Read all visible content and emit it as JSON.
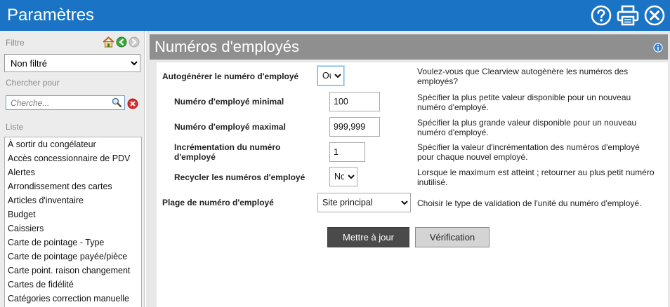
{
  "window": {
    "title": "Paramètres",
    "icons": [
      "help-icon",
      "print-icon",
      "close-icon"
    ]
  },
  "sidebar": {
    "filter_label": "Filtre",
    "filter_value": "Non filtré",
    "search_label": "Chercher pour",
    "search_placeholder": "Cherche...",
    "list_label": "Liste",
    "items": [
      "À sortir du congélateur",
      "Accès concessionnaire de PDV",
      "Alertes",
      "Arrondissement des cartes",
      "Articles d'inventaire",
      "Budget",
      "Caissiers",
      "Carte de pointage - Type",
      "Carte de pointage payée/pièce",
      "Carte point. raison changement",
      "Cartes de fidélité",
      "Catégories correction manuelle"
    ]
  },
  "main": {
    "title": "Numéros d'employés",
    "fields": {
      "autogen": {
        "label": "Autogénérer le numéro d'employé",
        "value": "Oui",
        "description": "Voulez-vous que Clearview autogènère les numéros des employés?"
      },
      "min": {
        "label": "Numéro d'employé minimal",
        "value": "100",
        "description": "Spécifier la plus petite valeur disponible pour un nouveau numéro d'employé."
      },
      "max": {
        "label": "Numéro d'employé maximal",
        "value": "999,999",
        "description": "Spécifier la plus grande valeur disponible pour un nouveau numéro d'employé."
      },
      "increment": {
        "label": "Incrémentation du numéro d'employé",
        "value": "1",
        "description": "Spécifier la valeur d'incrémentation des numéros d'employé pour chaque nouvel employé."
      },
      "recycle": {
        "label": "Recycler les numéros d'employé",
        "value": "Non",
        "description": "Lorsque le maximum est atteint ; retourner au plus petit numéro inutilisé."
      },
      "range": {
        "label": "Plage de numéro d'employé",
        "value": "Site principal",
        "description": "Choisir le type de validation de l'unité du numéro d'employé."
      }
    },
    "buttons": {
      "update": "Mettre à jour",
      "verify": "Vérification"
    }
  },
  "colors": {
    "titlebar": "#1a73c4",
    "panel_header": "#8f8f8f",
    "update_button": "#4a4a4a",
    "verify_button": "#d4d4d4"
  }
}
